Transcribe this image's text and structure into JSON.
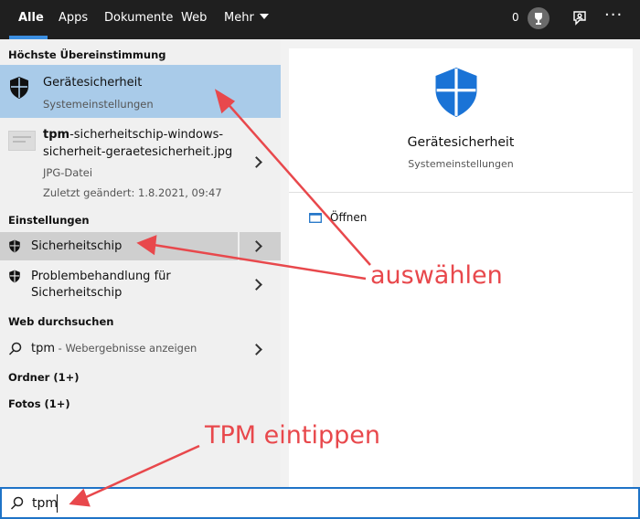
{
  "topbar": {
    "tabs": [
      {
        "label": "Alle"
      },
      {
        "label": "Apps"
      },
      {
        "label": "Dokumente"
      },
      {
        "label": "Web"
      },
      {
        "label": "Mehr"
      }
    ],
    "points": "0",
    "more": "···"
  },
  "left": {
    "best_match_heading": "Höchste Übereinstimmung",
    "best_match": {
      "title": "Gerätesicherheit",
      "subtitle": "Systemeinstellungen"
    },
    "file": {
      "title_bold": "tpm",
      "title_line1_rest": "-sicherheitschip-windows-",
      "title_line2": "sicherheit-geraetesicherheit.jpg",
      "type": "JPG-Datei",
      "modified": "Zuletzt geändert: 1.8.2021, 09:47"
    },
    "settings_heading": "Einstellungen",
    "settings": [
      {
        "title": "Sicherheitschip"
      },
      {
        "title_line1": "Problembehandlung für",
        "title_line2": "Sicherheitschip"
      }
    ],
    "web_heading": "Web durchsuchen",
    "web": {
      "query": "tpm",
      "suffix": " - Webergebnisse anzeigen"
    },
    "folders": "Ordner (1+)",
    "photos": "Fotos (1+)"
  },
  "right": {
    "title": "Gerätesicherheit",
    "subtitle": "Systemeinstellungen",
    "action": "Öffnen"
  },
  "search": {
    "value": "tpm"
  },
  "annotations": {
    "select": "auswählen",
    "type": "TPM eintippen"
  },
  "colors": {
    "accent": "#1f73c7",
    "shield": "#1a73d6",
    "annotation": "#e8484c",
    "selected": "#a9cbe9"
  }
}
